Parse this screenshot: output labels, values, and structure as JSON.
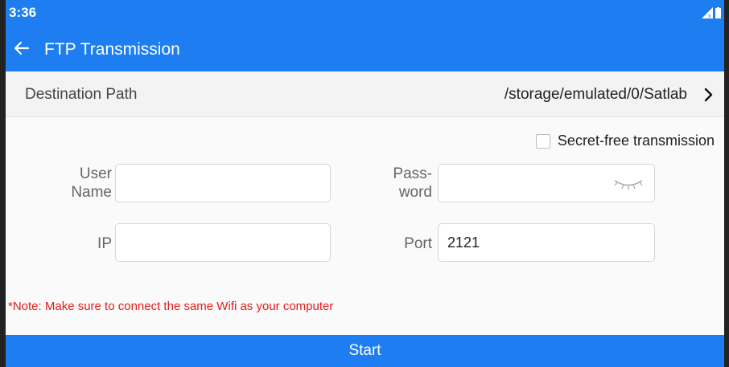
{
  "status_bar": {
    "time": "3:36",
    "signal_icon": "signal-icon",
    "battery_icon": "battery-icon"
  },
  "app_bar": {
    "back_icon": "arrow-left-icon",
    "title": "FTP Transmission"
  },
  "destination": {
    "label": "Destination Path",
    "value": "/storage/emulated/0/Satlab",
    "chevron_icon": "chevron-right-icon"
  },
  "options": {
    "secret_free_label": "Secret-free transmission",
    "secret_free_checked": false
  },
  "form": {
    "username": {
      "label_line1": "User",
      "label_line2": "Name",
      "value": ""
    },
    "password": {
      "label_line1": "Pass-",
      "label_line2": "word",
      "value": "",
      "toggle_icon": "eye-closed-icon"
    },
    "ip": {
      "label": "IP",
      "value": ""
    },
    "port": {
      "label": "Port",
      "value": "2121"
    }
  },
  "note": "*Note: Make sure to connect the same Wifi as your computer",
  "start_label": "Start",
  "colors": {
    "primary": "#1e7df0",
    "note_red": "#e41a1a",
    "row_bg": "#f3f3f3"
  }
}
